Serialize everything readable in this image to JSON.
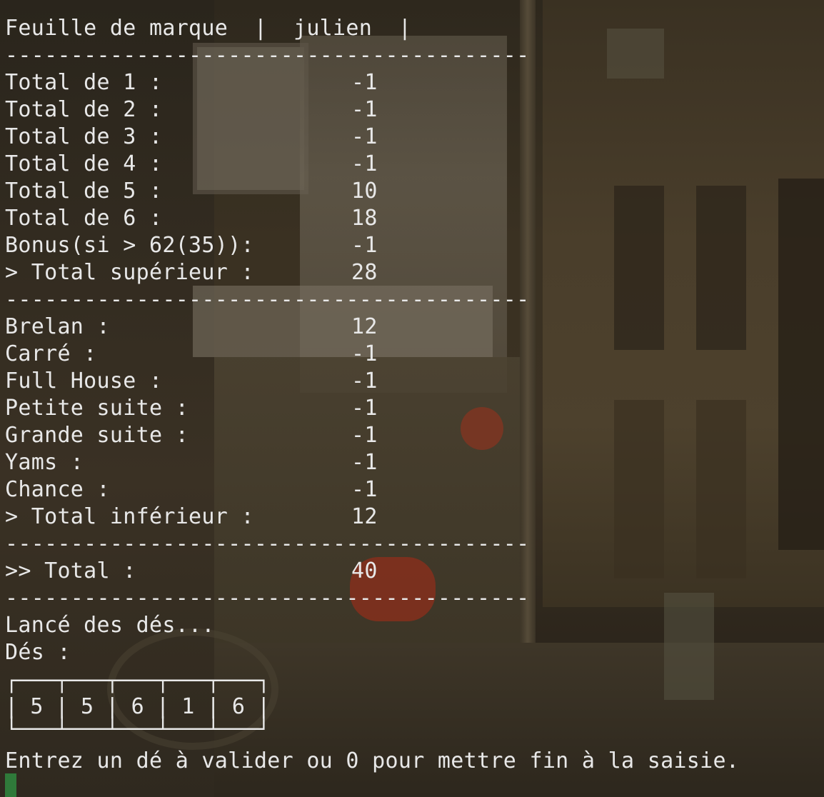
{
  "terminal": {
    "separator": "----------------------------------------",
    "header": "Feuille de marque  |  julien  |",
    "upper": [
      {
        "label": "Total de 1 :",
        "value": "-1"
      },
      {
        "label": "Total de 2 :",
        "value": "-1"
      },
      {
        "label": "Total de 3 :",
        "value": "-1"
      },
      {
        "label": "Total de 4 :",
        "value": "-1"
      },
      {
        "label": "Total de 5 :",
        "value": "10"
      },
      {
        "label": "Total de 6 :",
        "value": "18"
      },
      {
        "label": "Bonus(si > 62(35)):",
        "value": "-1"
      },
      {
        "label": "> Total supérieur :",
        "value": "28"
      }
    ],
    "lower": [
      {
        "label": "Brelan :",
        "value": "12"
      },
      {
        "label": "Carré :",
        "value": "-1"
      },
      {
        "label": "Full House :",
        "value": "-1"
      },
      {
        "label": "Petite suite :",
        "value": "-1"
      },
      {
        "label": "Grande suite :",
        "value": "-1"
      },
      {
        "label": "Yams :",
        "value": "-1"
      },
      {
        "label": "Chance :",
        "value": "-1"
      },
      {
        "label": "> Total inférieur :",
        "value": "12"
      }
    ],
    "total": {
      "label": ">> Total :",
      "value": "40"
    },
    "rolling": "Lancé des dés...",
    "dice_label": "Dés :",
    "dice_top": "┌───┬───┬───┬───┬───┐",
    "dice_row": "| 5 | 5 | 6 | 1 | 6 |",
    "dice_bottom": "└───┴───┴───┴───┴───┘",
    "prompt": "Entrez un dé à valider ou 0 pour mettre fin à la saisie."
  },
  "colors": {
    "text": "#e8e8e8",
    "cursor": "#2f7a3a"
  }
}
